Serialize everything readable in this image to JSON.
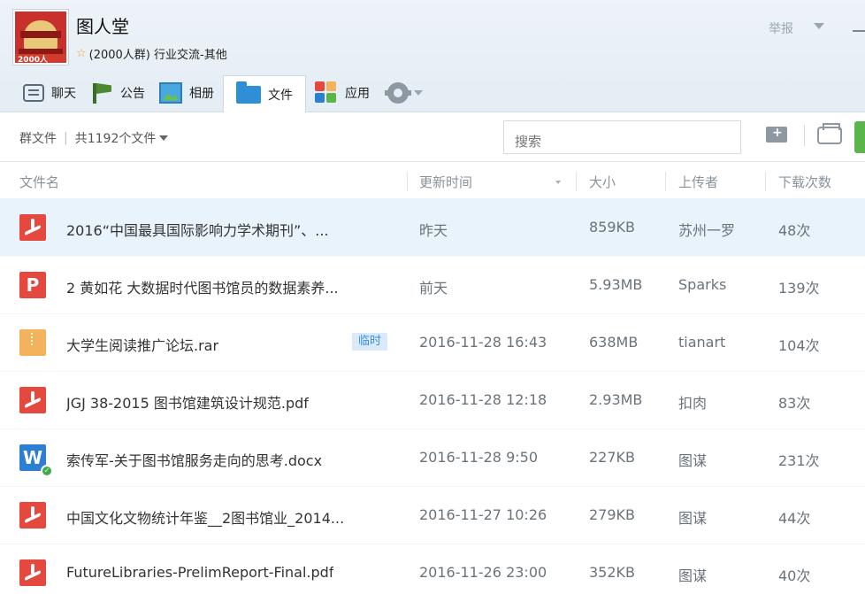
{
  "group": {
    "name": "图人堂",
    "member_info": "(2000人群) 行业交流-其他",
    "logo_tag": "2000人"
  },
  "header": {
    "report_label": "举报"
  },
  "tabs": [
    {
      "label": "聊天",
      "icon": "chat-icon"
    },
    {
      "label": "公告",
      "icon": "flag-icon"
    },
    {
      "label": "相册",
      "icon": "photo-icon"
    },
    {
      "label": "文件",
      "icon": "folder-icon",
      "active": true
    },
    {
      "label": "应用",
      "icon": "apps-icon"
    }
  ],
  "toolbar": {
    "group_files_label": "群文件",
    "file_count_label": "共1192个文件",
    "search_placeholder": "搜索"
  },
  "table": {
    "headers": [
      "文件名",
      "更新时间",
      "大小",
      "上传者",
      "下载次数"
    ],
    "rows": [
      {
        "type": "pdf",
        "name": "2016“中国最具国际影响力学术期刊”、...",
        "time": "昨天",
        "size": "859KB",
        "uploader": "苏州一罗",
        "downloads": "48次",
        "selected": true
      },
      {
        "type": "ppt",
        "name": "2 黄如花  大数据时代图书馆员的数据素养...",
        "time": "前天",
        "size": "5.93MB",
        "uploader": "Sparks",
        "downloads": "139次"
      },
      {
        "type": "rar",
        "name": "大学生阅读推广论坛.rar",
        "badge": "临时",
        "time": "2016-11-28 16:43",
        "size": "638MB",
        "uploader": "tianart",
        "downloads": "104次"
      },
      {
        "type": "pdf",
        "name": "JGJ 38-2015 图书馆建筑设计规范.pdf",
        "time": "2016-11-28 12:18",
        "size": "2.93MB",
        "uploader": "扣肉",
        "downloads": "83次"
      },
      {
        "type": "doc",
        "name": "索传军-关于图书馆服务走向的思考.docx",
        "time": "2016-11-28 9:50",
        "size": "227KB",
        "uploader": "图谋",
        "downloads": "231次"
      },
      {
        "type": "pdf",
        "name": "中国文化文物统计年鉴__2图书馆业_2014...",
        "time": "2016-11-27 10:26",
        "size": "279KB",
        "uploader": "图谋",
        "downloads": "44次"
      },
      {
        "type": "pdf",
        "name": "FutureLibraries-PrelimReport-Final.pdf",
        "time": "2016-11-26 23:00",
        "size": "352KB",
        "uploader": "图谋",
        "downloads": "40次"
      }
    ]
  },
  "colors": {
    "header_bg": "#e8eff5",
    "pdf_red": "#e5483f",
    "doc_blue": "#2d7fd3",
    "rar_orange": "#f2b35c",
    "selected_row": "#e9f3fc",
    "upload_green": "#5ab54b"
  }
}
